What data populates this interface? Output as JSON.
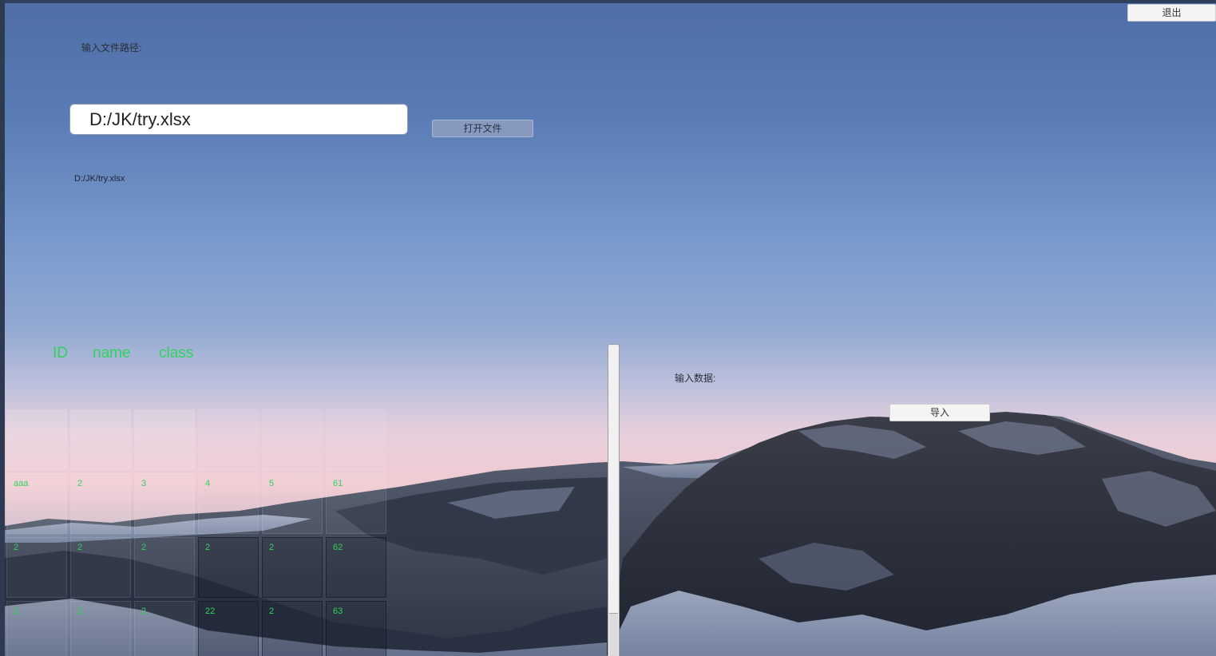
{
  "header": {
    "exit_label": "退出"
  },
  "file_section": {
    "path_label": "输入文件路径:",
    "path_value": "D:/JK/try.xlsx",
    "open_button_label": "打开文件",
    "selected_path_text": "D:/JK/try.xlsx"
  },
  "table": {
    "columns": [
      "ID",
      "name",
      "class"
    ],
    "rows": [
      [
        "",
        "",
        "",
        "",
        "",
        ""
      ],
      [
        "aaa",
        "2",
        "3",
        "4",
        "5",
        "61"
      ],
      [
        "2",
        "2",
        "2",
        "2",
        "2",
        "62"
      ],
      [
        "2",
        "2",
        "2",
        "22",
        "2",
        "63"
      ]
    ]
  },
  "data_section": {
    "input_label": "输入数据:",
    "import_button_label": "导入"
  },
  "colors": {
    "table_text": "#2fd35a",
    "sky_top": "#4f6ea8",
    "sky_horizon": "#f1cbd2"
  }
}
